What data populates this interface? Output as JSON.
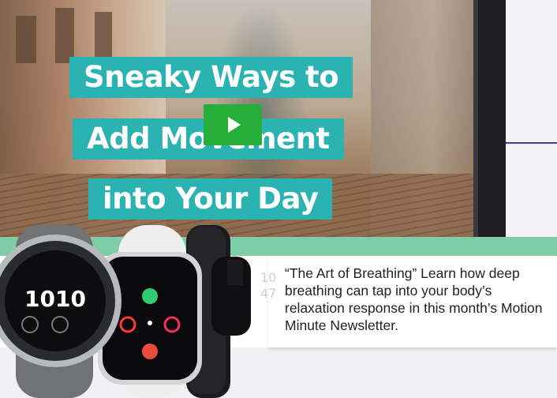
{
  "video": {
    "title_lines": [
      "Sneaky Ways to",
      "Add Movement",
      "into Your Day"
    ],
    "play_icon": "play-icon",
    "accent": "#2bb3b1",
    "play_color": "#27ad3a"
  },
  "feature": {
    "image": "smartwatches",
    "blurb": "“The Art of Breathing” Learn how deep breathing can tap into your body’s relaxation response in this month’s Motion Minute Newsletter.",
    "accent": "#7fcca8"
  },
  "watch_faces": {
    "garmin_time": "1010"
  }
}
